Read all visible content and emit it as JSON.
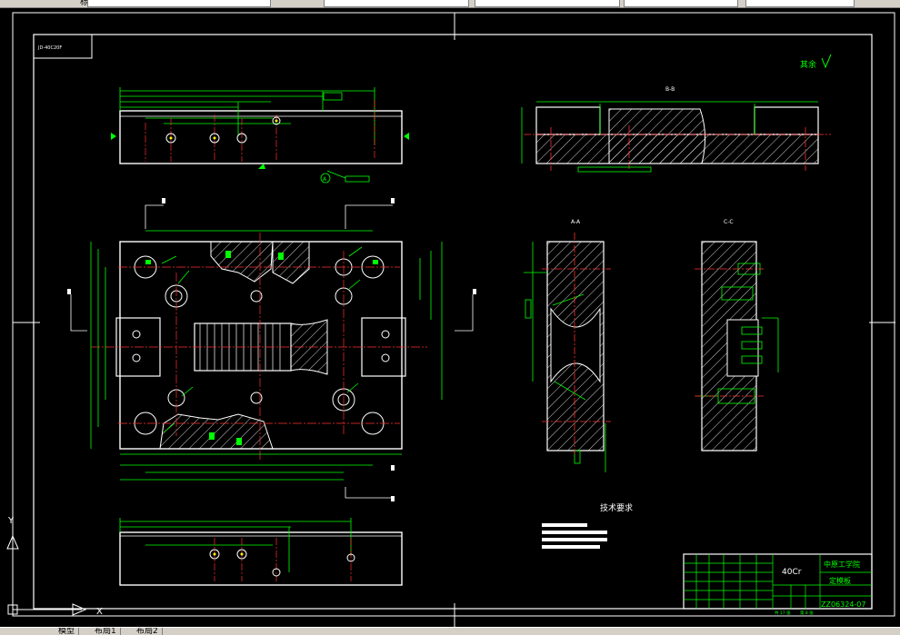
{
  "toolbar": {
    "items": [
      "标注"
    ],
    "layer_box": "",
    "style_box_1": "",
    "style_box_2": "",
    "color_box": "",
    "linetype_box": ""
  },
  "drawing": {
    "tag_label": "JD-40C20F",
    "section_bb": "B-B",
    "section_aa": "A-A",
    "section_cc": "C-C",
    "roughness_note": "其余",
    "tech_title": "技术要求",
    "datum_label": "A",
    "titleblock": {
      "material": "40Cr",
      "school": "中原工学院",
      "part_name": "定模板",
      "drawing_no": "ZZ06324-07",
      "sheet_info_1": "共 17 张",
      "sheet_info_2": "第 8 张"
    },
    "ucs": {
      "y": "Y",
      "x": "X"
    }
  },
  "statusbar": {
    "tabs": [
      "模型",
      "布局1",
      "布局2"
    ]
  },
  "colors": {
    "background": "#000000",
    "frame": "#ffffff",
    "dimension": "#00ff00",
    "hatch": "#ffffff",
    "centerline": "#ff3030",
    "accent": "#ffff00"
  }
}
